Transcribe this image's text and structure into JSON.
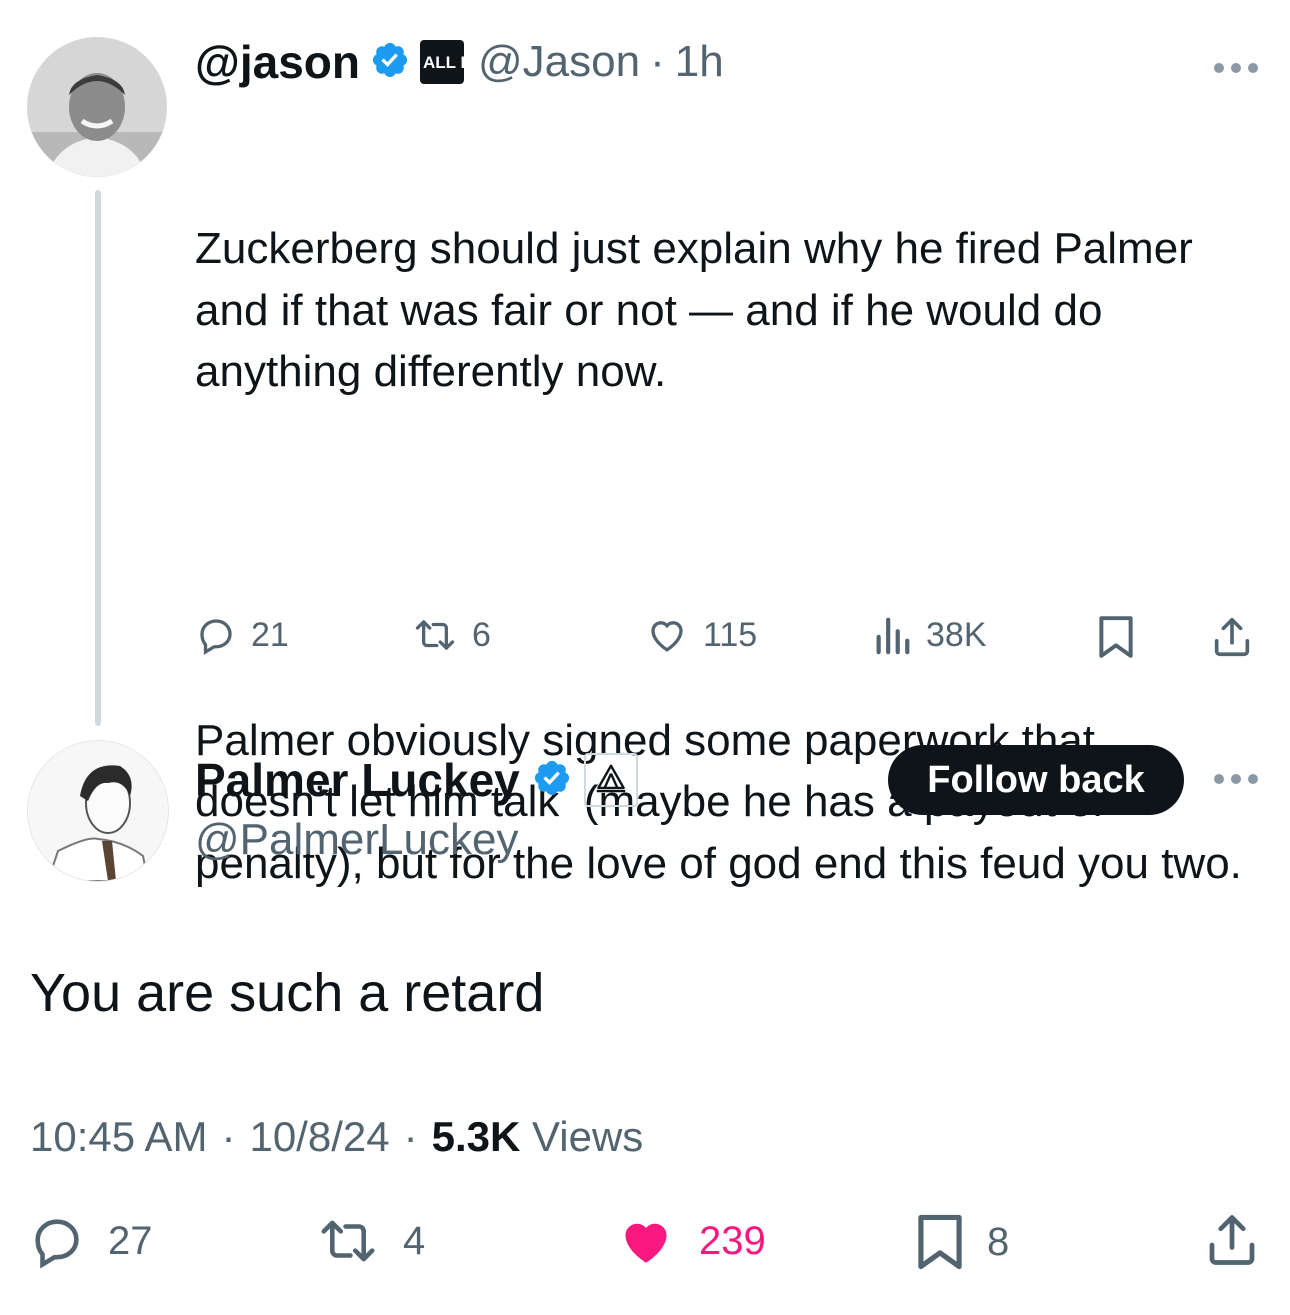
{
  "parent_tweet": {
    "display_name": "@jason",
    "badge_text": "ALL IN",
    "handle": "@Jason",
    "separator": "·",
    "time": "1h",
    "text_p1": "Zuckerberg should just explain why he fired Palmer and if that was fair or not — and if he would do anything differently now.",
    "text_p2": "Palmer obviously signed some paperwork that doesn’t let him talk  (maybe he has a payout or penalty), but for the love of god end this feud you two.",
    "replies": "21",
    "retweets": "6",
    "likes": "115",
    "views": "38K",
    "more_icon": "more-dots-icon"
  },
  "reply_tweet": {
    "display_name": "Palmer Luckey",
    "handle": "@PalmerLuckey",
    "follow_label": "Follow back",
    "text": "You are such a retard",
    "time": "10:45 AM",
    "date": "10/8/24",
    "separator": "·",
    "views_count": "5.3K",
    "views_label": "Views",
    "replies": "27",
    "retweets": "4",
    "likes": "239",
    "bookmarks": "8"
  },
  "colors": {
    "verified": "#1d9bf0",
    "like_active": "#f91880",
    "muted": "#536471",
    "button_bg": "#0f1419"
  }
}
